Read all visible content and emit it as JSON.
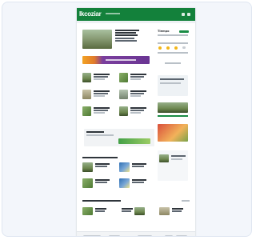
{
  "app": {
    "logo_text": "Ikcoziar"
  },
  "sections": {
    "weather_label": "Tiempo",
    "promo": "",
    "news_block": "",
    "footer": ""
  },
  "colors": {
    "brand_green": "#13813b",
    "banner_purple": "#6a3593",
    "banner_orange": "#f3a323",
    "page_bg": "#ffffff",
    "frame_bg": "#f3f6fb"
  },
  "icons": {
    "search": "search-icon",
    "menu": "menu-icon",
    "weather_sun": "sun-icon",
    "weather_cloud": "cloud-icon"
  }
}
